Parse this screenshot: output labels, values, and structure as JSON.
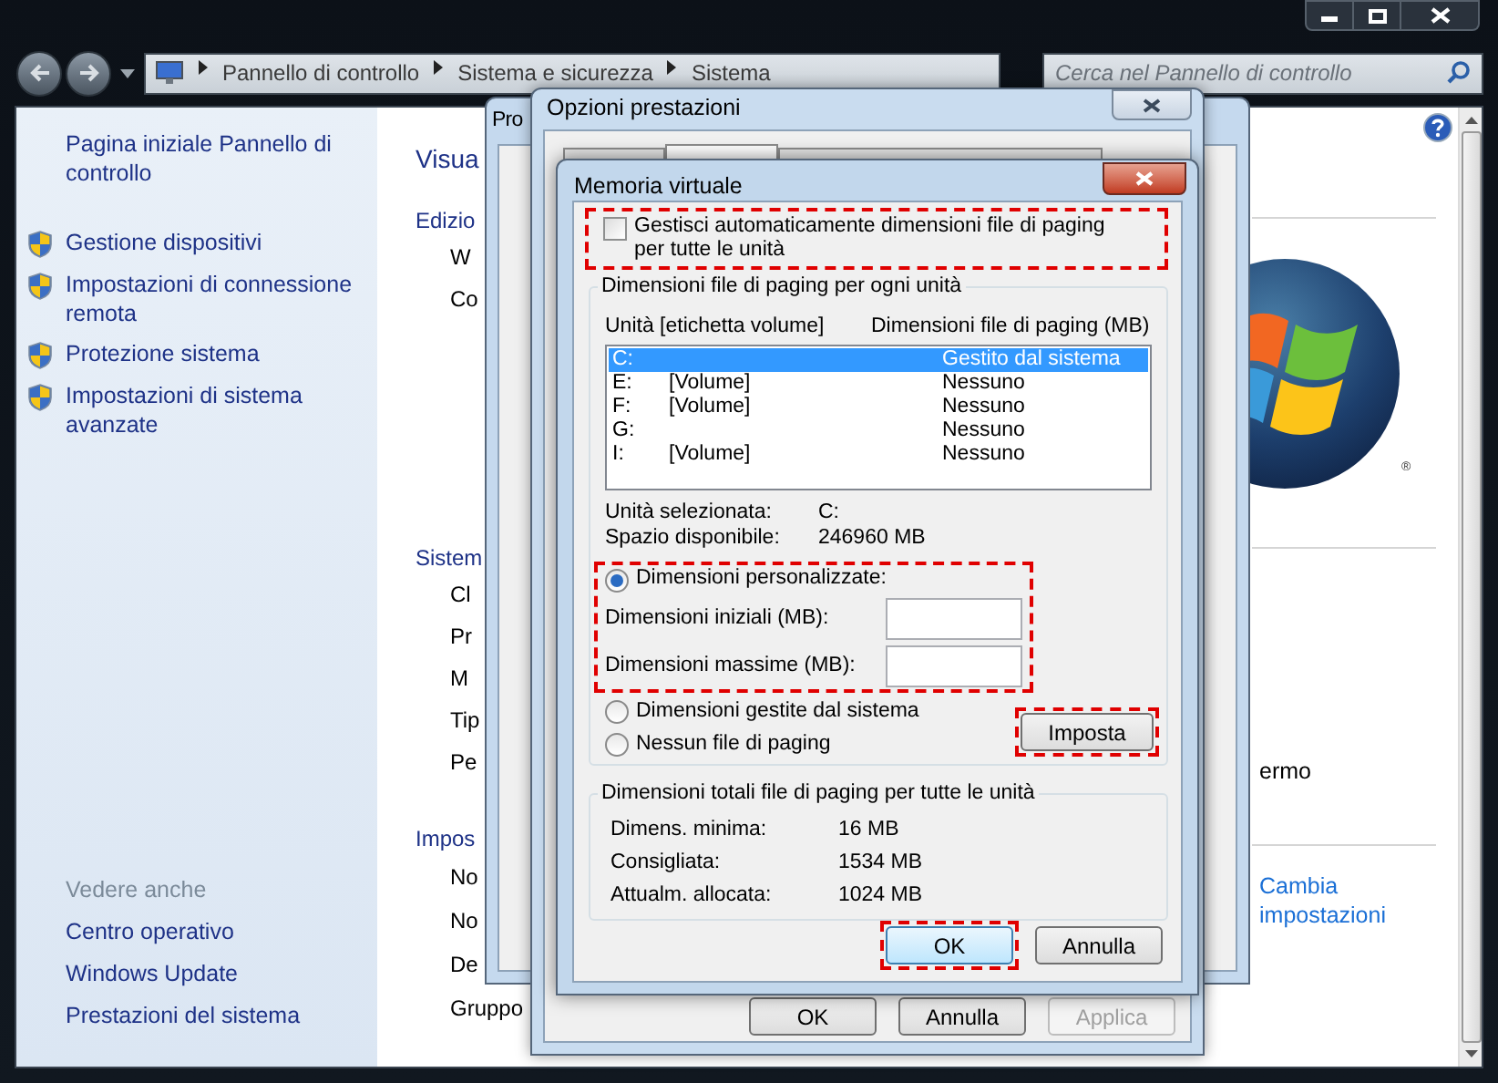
{
  "nav": {
    "breadcrumb": [
      "Pannello di controllo",
      "Sistema e sicurezza",
      "Sistema"
    ],
    "search": {
      "placeholder": "Cerca nel Pannello di controllo"
    }
  },
  "sidebar": {
    "home_link": "Pagina iniziale Pannello di controllo",
    "tasks": [
      "Gestione dispositivi",
      "Impostazioni di connessione remota",
      "Protezione sistema",
      "Impostazioni di sistema avanzate"
    ],
    "see_also": {
      "heading": "Vedere anche",
      "links": [
        "Centro operativo",
        "Windows Update",
        "Prestazioni del sistema"
      ]
    }
  },
  "main": {
    "title": "Visua",
    "sections": [
      {
        "heading": "Edizio",
        "items": [
          "W",
          "Co"
        ]
      },
      {
        "heading": "Sistem",
        "items": [
          "Cl",
          "Pr",
          "M",
          "Tip",
          "Pe"
        ]
      },
      {
        "heading": "Impos",
        "items": [
          "No",
          "No",
          "De",
          "Gruppo"
        ]
      }
    ],
    "logo_mark": "®",
    "side_text": "ermo",
    "change_link": "Cambia impostazioni"
  },
  "system_properties": {
    "title": "Pro"
  },
  "performance_options": {
    "title": "Opzioni prestazioni",
    "tabs": [
      {
        "selected": false
      },
      {
        "selected": true
      },
      {
        "selected": false
      }
    ],
    "buttons": [
      {
        "label": "OK",
        "disabled": false
      },
      {
        "label": "Annulla",
        "disabled": false
      },
      {
        "label": "Applica",
        "disabled": true
      }
    ]
  },
  "virtual_memory": {
    "title": "Memoria virtuale",
    "auto_manage": {
      "label": "Gestisci automaticamente dimensioni file di paging per tutte le unità",
      "checked": false,
      "highlighted": true
    },
    "per_drive": {
      "heading": "Dimensioni file di paging per ogni unità",
      "columns": [
        "Unità [etichetta volume]",
        "Dimensioni file di paging (MB)"
      ],
      "rows": [
        {
          "drive": "C:",
          "size": "Gestito dal sistema",
          "selected": true
        },
        {
          "drive": "E:",
          "label": "[Volume]",
          "size": "Nessuno",
          "selected": false
        },
        {
          "drive": "F:",
          "label": "[Volume]",
          "size": "Nessuno",
          "selected": false
        },
        {
          "drive": "G:",
          "size": "Nessuno",
          "selected": false
        },
        {
          "drive": "I:",
          "label": "[Volume]",
          "size": "Nessuno",
          "selected": false
        }
      ],
      "info": [
        {
          "label": "Unità selezionata:",
          "value": "C:"
        },
        {
          "label": "Spazio disponibile:",
          "value": "246960 MB"
        }
      ],
      "custom": {
        "label": "Dimensioni personalizzate:",
        "selected": true,
        "highlighted": true,
        "fields": [
          {
            "label": "Dimensioni iniziali (MB):"
          },
          {
            "label": "Dimensioni massime (MB):"
          }
        ]
      },
      "options": [
        {
          "label": "Dimensioni gestite dal sistema",
          "selected": false
        },
        {
          "label": "Nessun file di paging",
          "selected": false
        }
      ],
      "set_button": {
        "label": "Imposta",
        "highlighted": true
      }
    },
    "totals": {
      "heading": "Dimensioni totali file di paging per tutte le unità",
      "rows": [
        {
          "label": "Dimens. minima:",
          "value": "16 MB"
        },
        {
          "label": "Consigliata:",
          "value": "1534 MB"
        },
        {
          "label": "Attualm. allocata:",
          "value": "1024 MB"
        }
      ]
    },
    "buttons": [
      {
        "label": "OK",
        "highlighted": true
      },
      {
        "label": "Annulla",
        "highlighted": false
      }
    ]
  }
}
